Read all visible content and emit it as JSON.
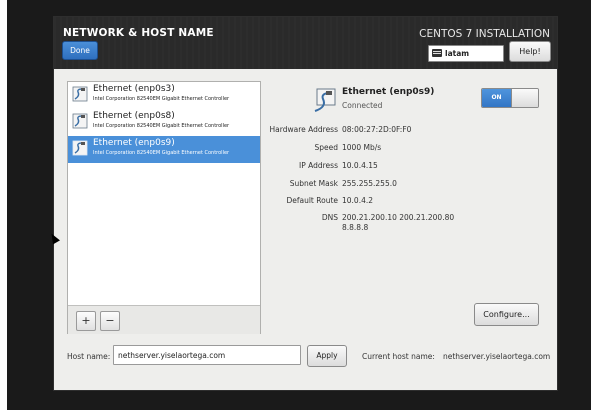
{
  "header": {
    "title": "NETWORK & HOST NAME",
    "done_label": "Done",
    "product": "CENTOS 7 INSTALLATION",
    "keyboard_layout": "latam",
    "help_label": "Help!"
  },
  "devices": [
    {
      "name": "Ethernet (enp0s3)",
      "description": "Intel Corporation 82540EM Gigabit Ethernet Controller",
      "selected": false
    },
    {
      "name": "Ethernet (enp0s8)",
      "description": "Intel Corporation 82540EM Gigabit Ethernet Controller",
      "selected": false
    },
    {
      "name": "Ethernet (enp0s9)",
      "description": "Intel Corporation 82540EM Gigabit Ethernet Controller",
      "selected": true
    }
  ],
  "list_toolbar": {
    "add_label": "+",
    "remove_label": "−"
  },
  "details": {
    "name": "Ethernet (enp0s9)",
    "status": "Connected",
    "toggle_label": "ON",
    "rows": [
      {
        "label": "Hardware Address",
        "value": "08:00:27:2D:0F:F0"
      },
      {
        "label": "Speed",
        "value": "1000 Mb/s"
      },
      {
        "label": "IP Address",
        "value": "10.0.4.15"
      },
      {
        "label": "Subnet Mask",
        "value": "255.255.255.0"
      },
      {
        "label": "Default Route",
        "value": "10.0.4.2"
      },
      {
        "label": "DNS",
        "value": "200.21.200.10 200.21.200.80 8.8.8.8"
      }
    ],
    "configure_label": "Configure..."
  },
  "hostname": {
    "label": "Host name:",
    "value": "nethserver.yiselaortega.com",
    "apply_label": "Apply",
    "current_label": "Current host name:",
    "current_value": "nethserver.yiselaortega.com"
  },
  "colors": {
    "accent": "#4a90d9",
    "header": "#2a2a2a",
    "background": "#eeeeec"
  }
}
